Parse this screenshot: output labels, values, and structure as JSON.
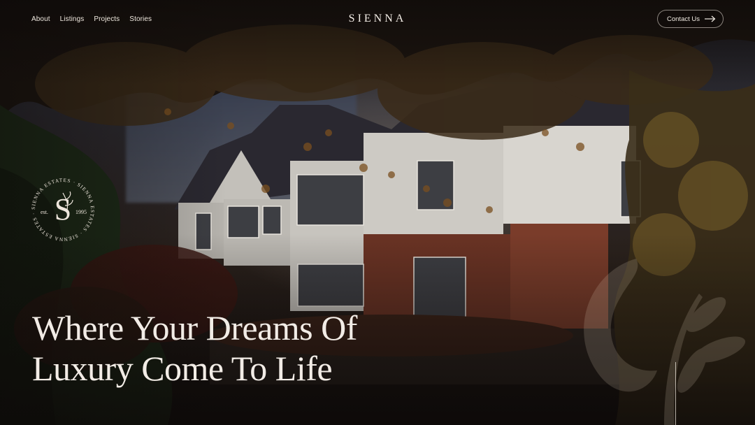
{
  "nav": {
    "links": [
      "About",
      "Listings",
      "Projects",
      "Stories"
    ],
    "brand": "SIENNA",
    "contact_label": "Contact Us"
  },
  "seal": {
    "ring_text": "SIENNA ESTATES · SIENNA ESTATES · SIENNA ESTATES ·",
    "est_label": "est.",
    "year": "1995",
    "monogram": "S"
  },
  "hero": {
    "headline_line1": "Where Your Dreams Of",
    "headline_line2": "Luxury Come To Life"
  },
  "icons": {
    "contact_arrow": "arrow-right-icon"
  },
  "colors": {
    "text": "#f2ece6",
    "background": "#15100d"
  }
}
